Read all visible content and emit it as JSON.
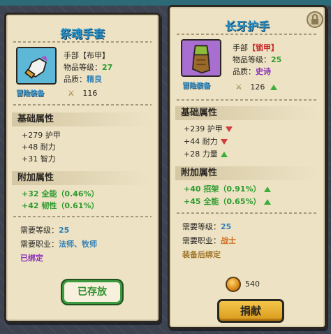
{
  "left": {
    "title": "祭魂手套",
    "type_line": "手部【布甲】",
    "level_label": "物品等级：",
    "level_value": "27",
    "quality_label": "品质：",
    "quality_value": "精良",
    "badge": "冒险装备",
    "score": "116",
    "base_header": "基础属性",
    "base_stats": [
      "+279 护甲",
      "+48 耐力",
      "+31 智力"
    ],
    "extra_header": "附加属性",
    "extra_stats": [
      "+32 全能（0.46%）",
      "+42 韧性（0.61%）"
    ],
    "req_level_label": "需要等级：",
    "req_level_value": "25",
    "req_class_label": "需要职业：",
    "req_class_value": "法师、牧师",
    "bound": "已绑定",
    "button": "已存放"
  },
  "right": {
    "title": "长牙护手",
    "type_line_prefix": "手部",
    "type_line_armor": "【锁甲】",
    "level_label": "物品等级：",
    "level_value": "25",
    "quality_label": "品质：",
    "quality_value": "史诗",
    "badge": "冒险装备",
    "score": "126",
    "base_header": "基础属性",
    "base_stats": [
      "+239 护甲",
      "+44 耐力",
      "+28 力量"
    ],
    "base_dirs": [
      "down",
      "down",
      "up"
    ],
    "extra_header": "附加属性",
    "extra_stats": [
      "+40 招架（0.91%）",
      "+45 全能（0.65%）"
    ],
    "req_level_label": "需要等级：",
    "req_level_value": "25",
    "req_class_label": "需要职业：",
    "req_class_value": "战士",
    "bind_note": "装备后绑定",
    "price": "540",
    "button": "捐献"
  },
  "colors": {
    "title_blue": "#2e93c9",
    "green": "#2e9a2e",
    "red": "#c82a2a",
    "gold_button": "#f3c64a"
  }
}
